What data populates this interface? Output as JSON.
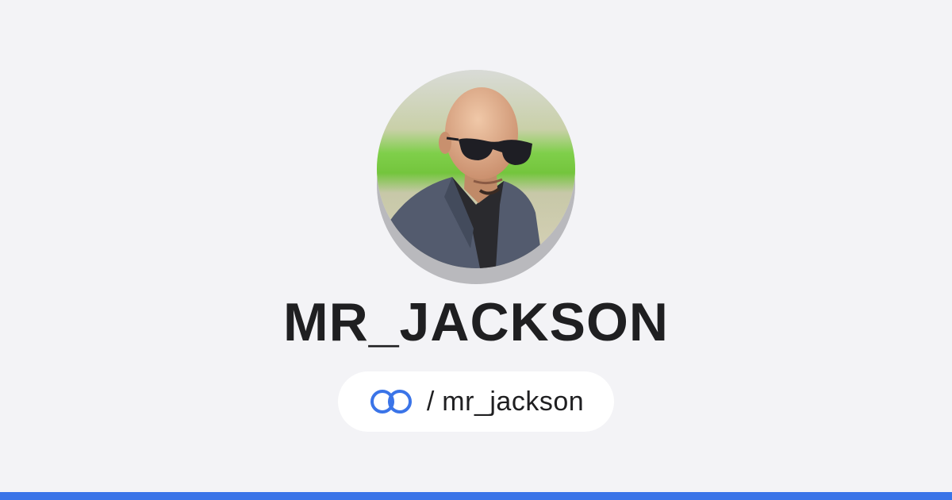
{
  "profile": {
    "display_name": "MR_JACKSON",
    "handle_separator": "/",
    "handle": "mr_jackson",
    "avatar_alt": "Profile photo"
  },
  "brand": {
    "logo_icon": "linked-rings-icon",
    "accent_color": "#3a74e8",
    "background_color": "#f3f3f6"
  }
}
